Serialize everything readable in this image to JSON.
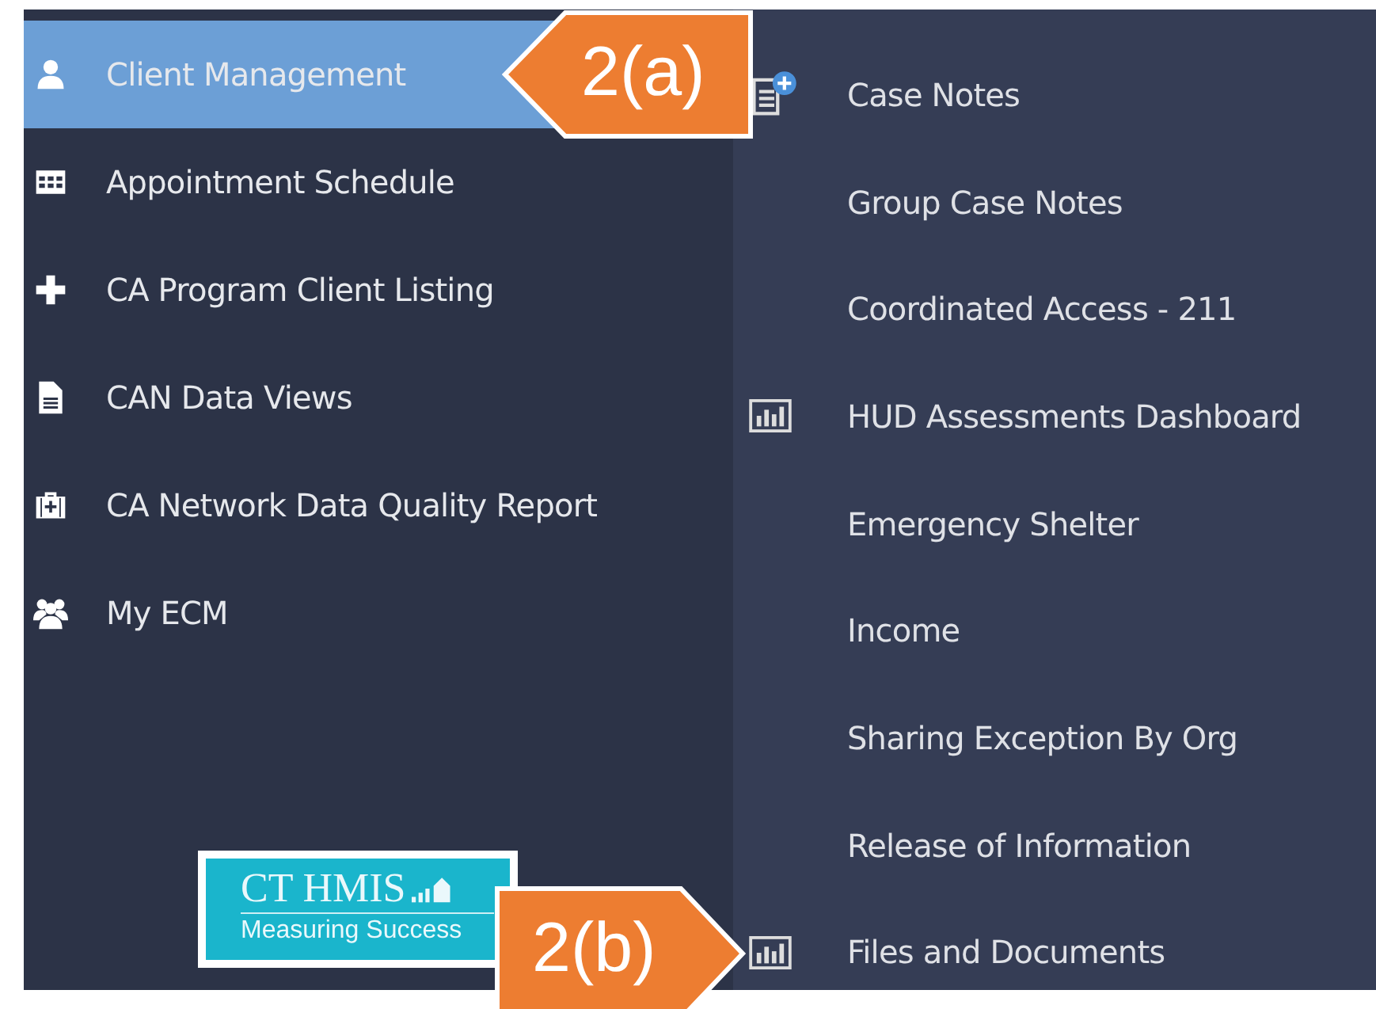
{
  "sidebar": {
    "items": [
      {
        "label": "Client Management",
        "selected": true
      },
      {
        "label": "Appointment Schedule",
        "selected": false
      },
      {
        "label": "CA Program Client Listing",
        "selected": false
      },
      {
        "label": "CAN Data Views",
        "selected": false
      },
      {
        "label": "CA Network Data Quality Report",
        "selected": false
      },
      {
        "label": "My ECM",
        "selected": false
      }
    ],
    "logo": {
      "title": "CT HMIS",
      "tagline": "Measuring Success"
    }
  },
  "submenu": {
    "items": [
      {
        "label": "Case Notes"
      },
      {
        "label": "Group Case Notes"
      },
      {
        "label": "Coordinated Access - 211"
      },
      {
        "label": "HUD Assessments Dashboard"
      },
      {
        "label": "Emergency Shelter"
      },
      {
        "label": "Income"
      },
      {
        "label": "Sharing Exception By Org"
      },
      {
        "label": "Release of Information"
      },
      {
        "label": "Files and Documents"
      }
    ]
  },
  "callouts": [
    {
      "label": "2(a)",
      "kind": "left"
    },
    {
      "label": "2(b)",
      "kind": "right"
    }
  ]
}
